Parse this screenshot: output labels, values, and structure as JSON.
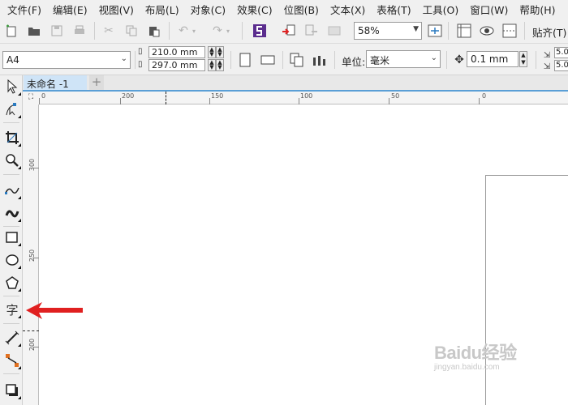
{
  "menu": [
    "文件(F)",
    "编辑(E)",
    "视图(V)",
    "布局(L)",
    "对象(C)",
    "效果(C)",
    "位图(B)",
    "文本(X)",
    "表格(T)",
    "工具(O)",
    "窗口(W)",
    "帮助(H)"
  ],
  "toolbar": {
    "zoom_value": "58%",
    "snap_label": "贴齐(T)"
  },
  "property_bar": {
    "page_size": "A4",
    "width": "210.0 mm",
    "height": "297.0 mm",
    "unit_label": "单位:",
    "unit_value": "毫米",
    "nudge_value": "0.1 mm",
    "dup_x": "5.0",
    "dup_y": "5.0"
  },
  "document": {
    "tab_title": "未命名 -1",
    "add_tab": "+"
  },
  "rulers": {
    "horizontal": [
      "0",
      "200",
      "150",
      "100",
      "50",
      "0"
    ],
    "vertical": [
      "300",
      "250",
      "200"
    ]
  },
  "toolbox": {
    "tools": [
      "pick-tool-icon",
      "shape-tool-icon",
      "crop-tool-icon",
      "zoom-tool-icon",
      "freehand-tool-icon",
      "artistic-media-icon",
      "rectangle-tool-icon",
      "ellipse-tool-icon",
      "polygon-tool-icon",
      "text-tool-icon",
      "parallel-dimension-icon",
      "connector-tool-icon",
      "drop-shadow-icon"
    ],
    "text_tool_glyph": "字"
  },
  "annotation": {
    "arrow_color": "#e02020"
  },
  "watermark": {
    "brand": "Baidu经验",
    "url": "jingyan.baidu.com"
  }
}
